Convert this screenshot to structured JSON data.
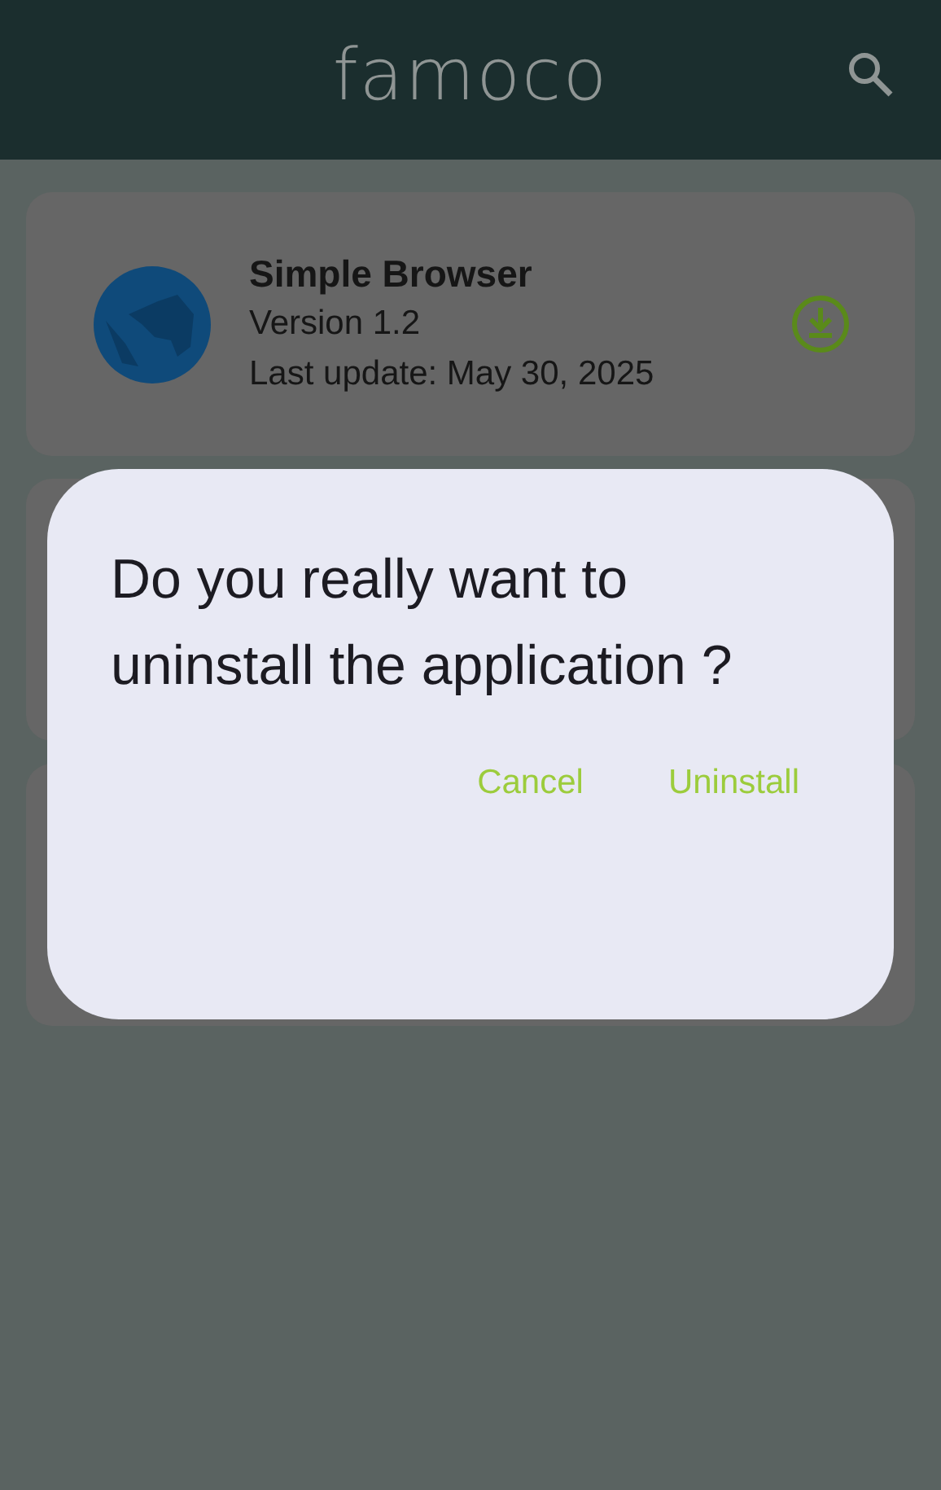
{
  "app_bar": {
    "title": "famoco"
  },
  "apps": [
    {
      "name": "Simple Browser",
      "version": "Version 1.2",
      "last_update": "Last update: May 30, 2025"
    }
  ],
  "dialog": {
    "message": "Do you really want to uninstall the application ?",
    "buttons": [
      "Cancel",
      "Uninstall"
    ]
  }
}
